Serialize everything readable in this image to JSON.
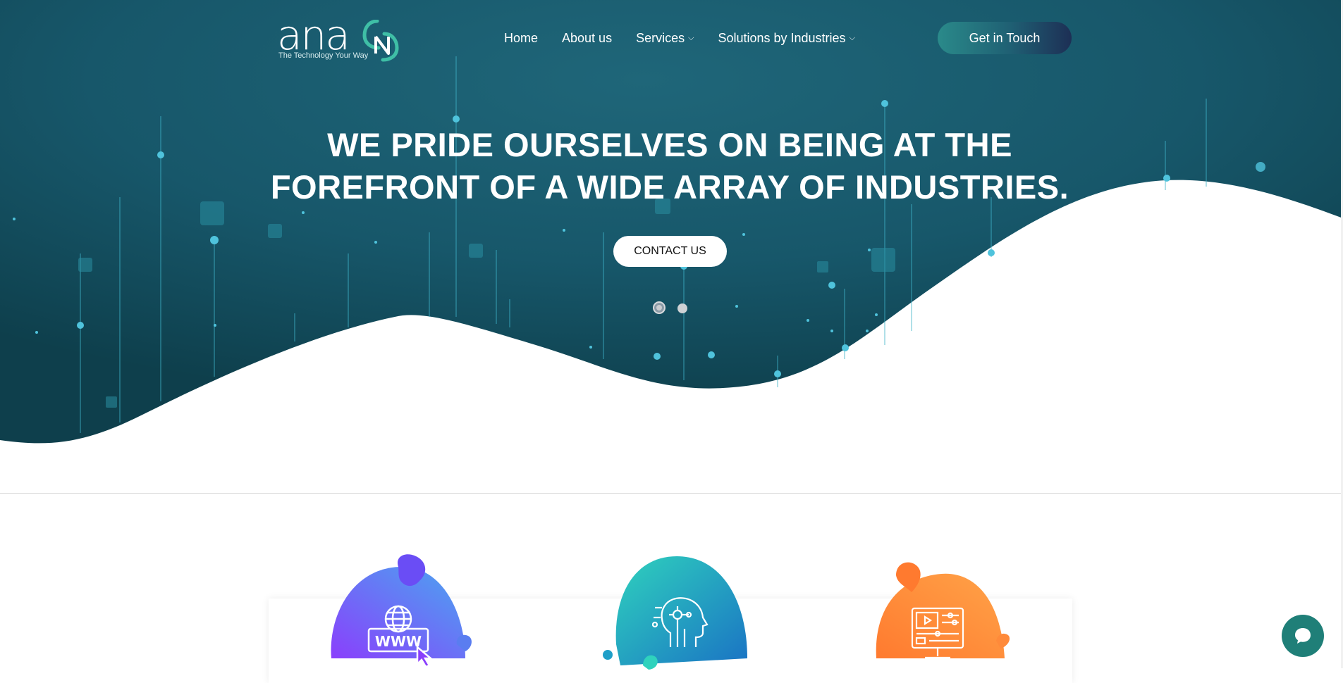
{
  "header": {
    "logo_text": "ana",
    "logo_tagline": "The Technology Your Way",
    "nav": [
      {
        "label": "Home",
        "has_dropdown": false
      },
      {
        "label": "About us",
        "has_dropdown": false
      },
      {
        "label": "Services",
        "has_dropdown": true
      },
      {
        "label": "Solutions by Industries",
        "has_dropdown": true
      }
    ],
    "cta_label": "Get in Touch"
  },
  "hero": {
    "title": "WE PRIDE OURSELVES ON BEING AT THE FOREFRONT OF A WIDE ARRAY OF INDUSTRIES.",
    "contact_label": "CONTACT US",
    "slides": {
      "count": 2,
      "active": 1
    }
  },
  "services": {
    "cards": [
      {
        "icon": "www-cursor-icon",
        "color_start": "#8a3ffc",
        "color_end": "#4aa6f0"
      },
      {
        "icon": "ai-head-icon",
        "color_start": "#2fd2bd",
        "color_end": "#1a73c4"
      },
      {
        "icon": "video-monitor-icon",
        "color_start": "#ff7a2f",
        "color_end": "#ffa348"
      }
    ]
  },
  "chat": {
    "icon": "chat-bubble-icon"
  },
  "colors": {
    "hero_dark": "#0f4452",
    "hero_mid": "#1e6276",
    "accent_teal": "#4fc3dc",
    "chat_green": "#1f7f78"
  }
}
